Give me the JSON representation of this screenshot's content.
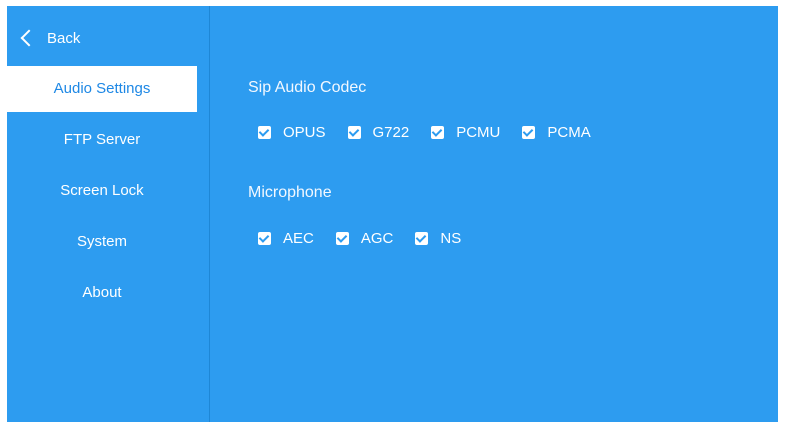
{
  "back": {
    "label": "Back"
  },
  "sidebar": {
    "items": [
      {
        "label": "Audio Settings",
        "active": true
      },
      {
        "label": "FTP Server",
        "active": false
      },
      {
        "label": "Screen Lock",
        "active": false
      },
      {
        "label": "System",
        "active": false
      },
      {
        "label": "About",
        "active": false
      }
    ]
  },
  "main": {
    "codec": {
      "title": "Sip Audio Codec",
      "options": [
        {
          "label": "OPUS",
          "checked": true
        },
        {
          "label": "G722",
          "checked": true
        },
        {
          "label": "PCMU",
          "checked": true
        },
        {
          "label": "PCMA",
          "checked": true
        }
      ]
    },
    "microphone": {
      "title": "Microphone",
      "options": [
        {
          "label": "AEC",
          "checked": true
        },
        {
          "label": "AGC",
          "checked": true
        },
        {
          "label": "NS",
          "checked": true
        }
      ]
    }
  },
  "colors": {
    "background": "#2d9cf0",
    "active_item_bg": "#ffffff",
    "active_item_text": "#1e88e5"
  },
  "icons": {
    "back": "chevron-left-icon",
    "checkbox": "checkbox-checked-icon"
  }
}
